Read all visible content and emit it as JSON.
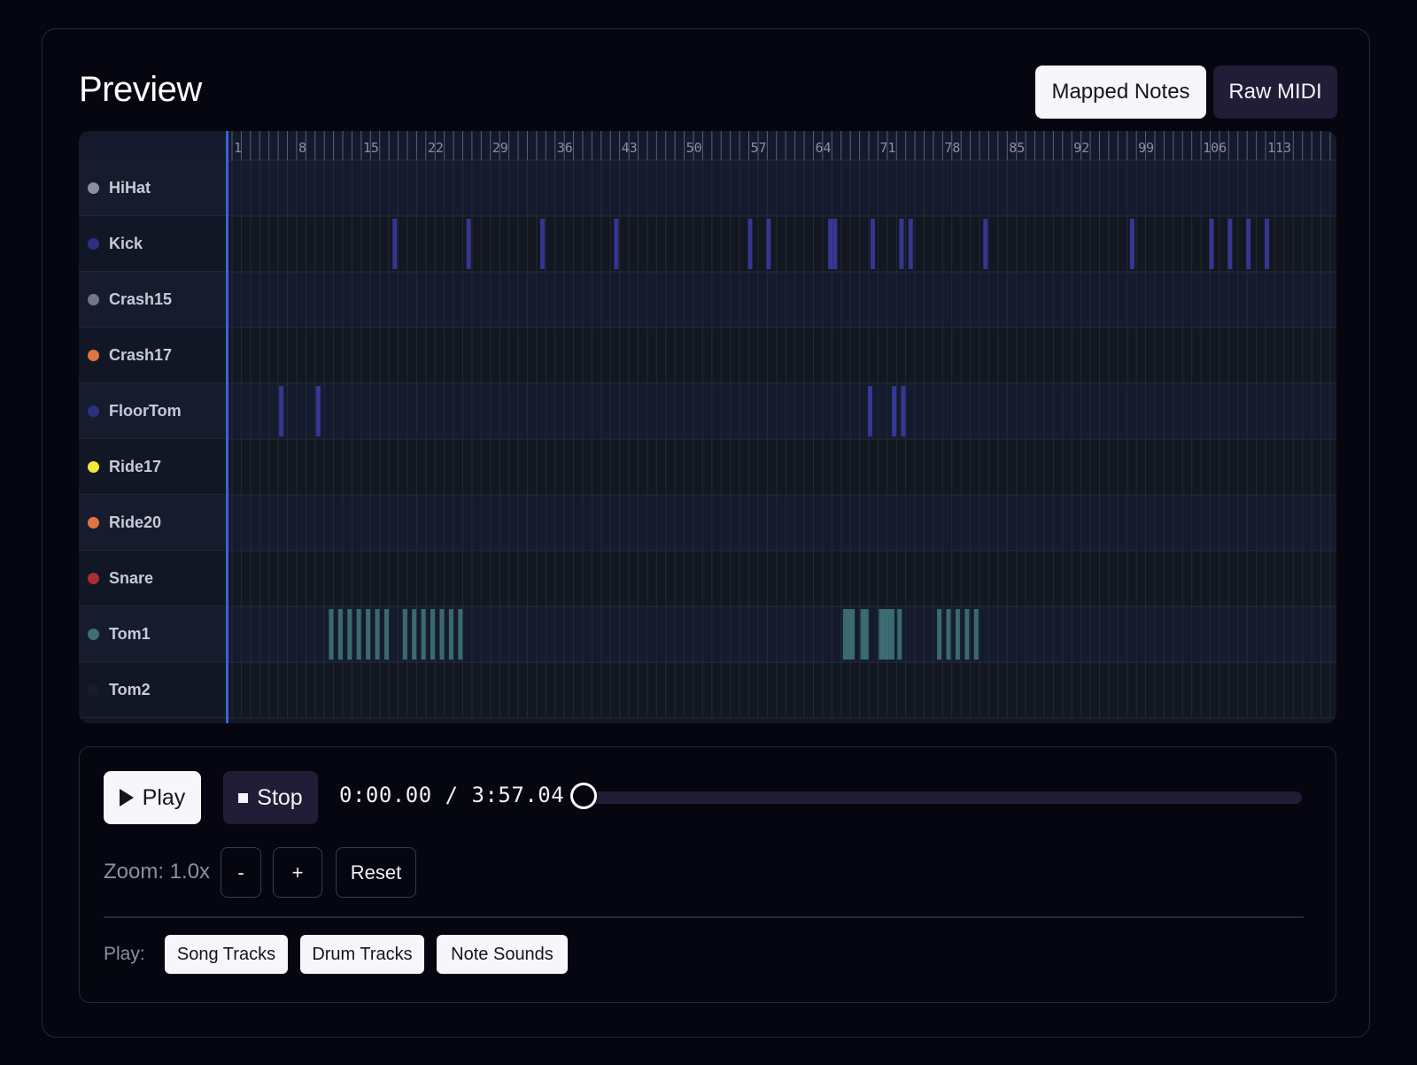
{
  "preview": {
    "title": "Preview"
  },
  "view_toggle": {
    "mapped_label": "Mapped Notes",
    "raw_label": "Raw MIDI",
    "active": "mapped"
  },
  "ruler": {
    "labels": [
      "1",
      "8",
      "15",
      "22",
      "29",
      "36",
      "43",
      "50",
      "57",
      "64",
      "71",
      "78",
      "85",
      "92",
      "99",
      "106",
      "113"
    ]
  },
  "tracks": [
    {
      "name": "HiHat",
      "color": "#8c8e9c",
      "note_color": "#3a3f9a",
      "notes": []
    },
    {
      "name": "Kick",
      "color": "#2d2f80",
      "note_color": "#3a3a9e",
      "notes": [
        18.4,
        26.4,
        34.4,
        42.4,
        56.9,
        58.9,
        65.6,
        66.1,
        70.2,
        73.3,
        74.3,
        82.4,
        98.3,
        106.9,
        108.9,
        110.9,
        112.9
      ]
    },
    {
      "name": "Crash15",
      "color": "#74758a",
      "note_color": "#5a5b72",
      "notes": []
    },
    {
      "name": "Crash17",
      "color": "#e0733f",
      "note_color": "#b05a30",
      "notes": []
    },
    {
      "name": "FloorTom",
      "color": "#2d2f80",
      "note_color": "#3a3a9e",
      "notes": [
        6.1,
        10.1,
        69.9,
        72.5,
        73.5
      ]
    },
    {
      "name": "Ride17",
      "color": "#f2ea3a",
      "note_color": "#b8b030",
      "notes": []
    },
    {
      "name": "Ride20",
      "color": "#e0733f",
      "note_color": "#b05a30",
      "notes": []
    },
    {
      "name": "Snare",
      "color": "#a8312f",
      "note_color": "#8a2a2a",
      "notes": []
    },
    {
      "name": "Tom1",
      "color": "#3f6e73",
      "note_color": "#3e7378",
      "notes": [
        11.5,
        12.5,
        13.5,
        14.5,
        15.5,
        16.5,
        17.5,
        19.5,
        20.5,
        21.5,
        22.5,
        23.5,
        24.5,
        25.5,
        67.2,
        67.6,
        68.0,
        69.1,
        69.5,
        71.1,
        71.5,
        71.9,
        72.3,
        73.1,
        77.4,
        78.4,
        79.4,
        80.4,
        81.4
      ]
    },
    {
      "name": "Tom2",
      "color": "#1a1d28",
      "note_color": "#2a2d3a",
      "notes": []
    }
  ],
  "transport": {
    "play_label": "Play",
    "stop_label": "Stop",
    "time_current": "0:00.00",
    "time_separator": "/",
    "time_total": "3:57.04",
    "position_fraction": 0.0
  },
  "zoom": {
    "label": "Zoom: 1.0x",
    "minus_label": "-",
    "plus_label": "+",
    "reset_label": "Reset"
  },
  "play_options": {
    "label": "Play:",
    "options": [
      "Song Tracks",
      "Drum Tracks",
      "Note Sounds"
    ]
  },
  "icons": {
    "play": "play-triangle-icon",
    "stop": "stop-square-icon"
  }
}
